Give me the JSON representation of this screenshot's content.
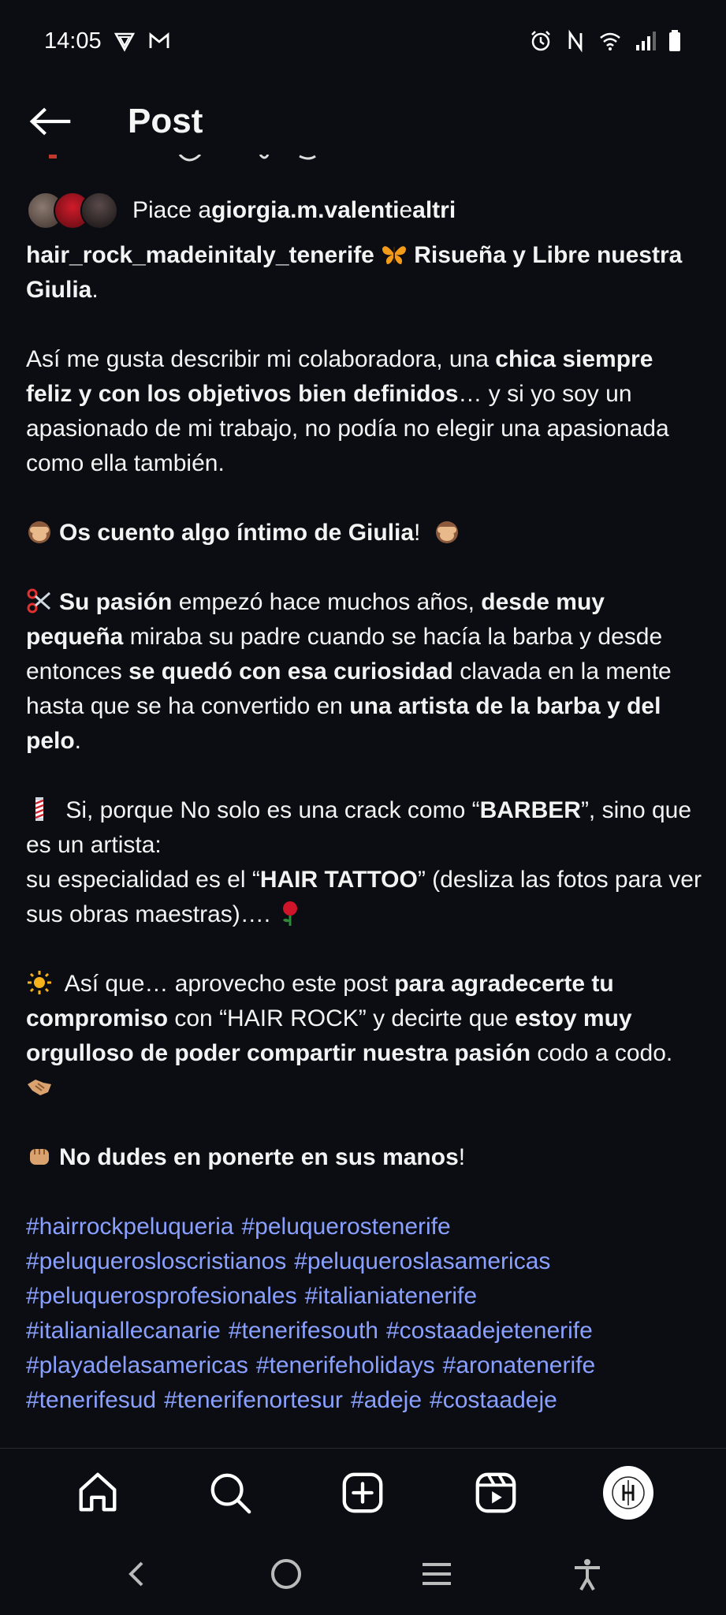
{
  "status": {
    "time": "14:05",
    "left_icons": [
      "vpn-shield-icon",
      "gmail-icon"
    ],
    "right_icons": [
      "alarm-icon",
      "nfc-icon",
      "wifi-icon",
      "signal-icon",
      "battery-icon"
    ]
  },
  "header": {
    "title": "Post"
  },
  "likes": {
    "prefix": "Piace a ",
    "user": "giorgia.m.valenti",
    "middle": " e ",
    "others": "altri"
  },
  "caption": {
    "author": "hair_rock_madeinitaly_tenerife",
    "l1_bold": "Risueña y Libre nuestra Giulia",
    "l1_end": ".",
    "p2_a": "Así me gusta describir mi colaboradora, una ",
    "p2_b": "chica siempre feliz y con los objetivos bien definidos",
    "p2_c": "… y si yo soy un apasionado de mi trabajo, no podía no elegir una apasionada como ella también.",
    "p3_b": "Os cuento algo íntimo de Giulia",
    "p3_c": "!",
    "p4_b1": "Su pasión",
    "p4_t1": " empezó hace muchos años, ",
    "p4_b2": "desde muy pequeña",
    "p4_t2": " miraba su padre cuando se hacía la barba y desde entonces ",
    "p4_b3": "se quedó con esa curiosidad",
    "p4_t3": " clavada en la mente hasta que se ha convertido en ",
    "p4_b4": "una artista de la barba y del pelo",
    "p4_t4": ".",
    "p5_t1": " Si, porque No solo es una crack como “",
    "p5_b1": "BARBER",
    "p5_t2": "”, sino que es un artista:",
    "p5_t3": "su especialidad es el “",
    "p5_b2": "HAIR TATTOO",
    "p5_t4": "” (desliza las fotos para ver sus obras maestras)…. ",
    "p6_t1": " Así que… aprovecho este post ",
    "p6_b1": "para agradecerte tu compromiso",
    "p6_t2": " con “HAIR ROCK” y decirte que ",
    "p6_b2": "estoy muy orgulloso de poder compartir nuestra pasión",
    "p6_t3": " codo a codo. ",
    "p7_b": "No dudes en ponerte en sus manos",
    "p7_t": "!",
    "hashtags": [
      "#hairrockpeluqueria",
      "#peluquerostenerife",
      "#peluquerosloscristianos",
      "#peluqueroslasamericas",
      "#peluquerosprofesionales",
      "#italianiatenerife",
      "#italianiallecanarie",
      "#tenerifesouth",
      "#costaadejetenerife",
      "#playadelasamericas",
      "#tenerifeholidays",
      "#aronatenerife",
      "#tenerifesud",
      "#tenerifenortesur",
      "#adeje",
      "#costaadeje"
    ]
  },
  "nav": {
    "items": [
      "home-icon",
      "search-icon",
      "create-icon",
      "reels-icon",
      "profile-avatar"
    ]
  },
  "colors": {
    "background": "#0b0d12",
    "hashtag": "#8aa0ff",
    "text": "#f5f5f5"
  }
}
